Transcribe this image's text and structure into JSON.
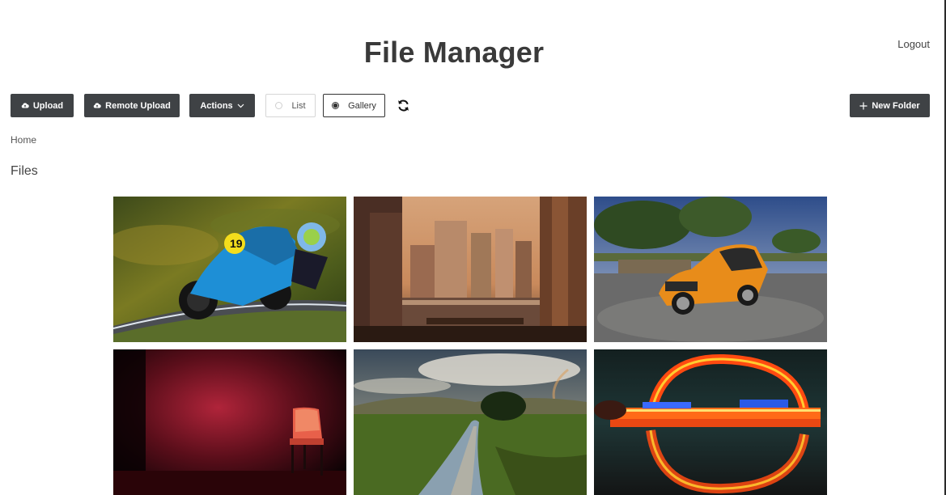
{
  "header": {
    "title": "File Manager",
    "logout_label": "Logout"
  },
  "toolbar": {
    "upload_label": "Upload",
    "remote_upload_label": "Remote Upload",
    "actions_label": "Actions",
    "view_list_label": "List",
    "view_gallery_label": "Gallery",
    "selected_view": "Gallery",
    "new_folder_label": "New Folder"
  },
  "breadcrumb": {
    "home_label": "Home"
  },
  "files": {
    "section_title": "Files",
    "items": [
      {
        "subject": "motorcycle-racer"
      },
      {
        "subject": "city-skyline-sunset"
      },
      {
        "subject": "orange-car"
      },
      {
        "subject": "red-chair-dark-room"
      },
      {
        "subject": "river-valley-rainbow"
      },
      {
        "subject": "neon-arch-reflection"
      }
    ]
  },
  "colors": {
    "button_dark": "#3f4245",
    "title_text": "#3a3a3a",
    "background": "#ffffff"
  },
  "icons": {
    "upload": "cloud-upload-icon",
    "remote_upload": "cloud-upload-icon",
    "actions": "chevron-down-icon",
    "refresh": "refresh-icon",
    "new_folder": "plus-icon"
  }
}
